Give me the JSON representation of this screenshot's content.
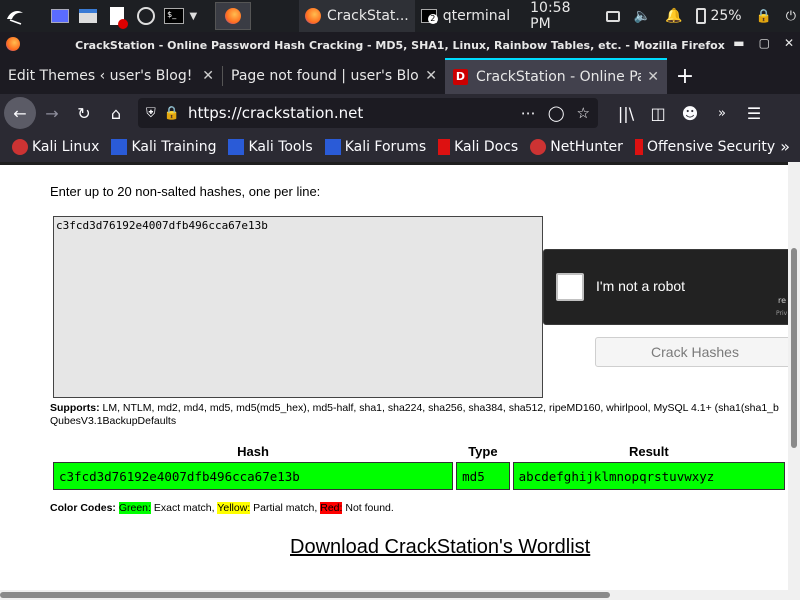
{
  "taskbar": {
    "apps": [
      {
        "icon": "firefox-icon",
        "label": "CrackStat..."
      },
      {
        "icon": "terminal-icon",
        "label": "qterminal",
        "badge": "2"
      }
    ],
    "clock": "10:58 PM",
    "battery": "25%"
  },
  "window": {
    "title": "CrackStation - Online Password Hash Cracking - MD5, SHA1, Linux, Rainbow Tables, etc. - Mozilla Firefox"
  },
  "tabs": [
    {
      "label": "Edit Themes ‹ user's Blog! —"
    },
    {
      "label": "Page not found | user's Blog!"
    },
    {
      "label": "CrackStation - Online Pas"
    }
  ],
  "urlbar": {
    "url": "https://crackstation.net"
  },
  "bookmarks": [
    {
      "label": "Kali Linux",
      "icon": "kali-dragon-icon"
    },
    {
      "label": "Kali Training",
      "icon": "kali-training-icon"
    },
    {
      "label": "Kali Tools",
      "icon": "kali-tools-icon"
    },
    {
      "label": "Kali Forums",
      "icon": "kali-forums-icon"
    },
    {
      "label": "Kali Docs",
      "icon": "kali-docs-icon"
    },
    {
      "label": "NetHunter",
      "icon": "nethunter-icon"
    },
    {
      "label": "Offensive Security",
      "icon": "offsec-icon"
    }
  ],
  "page": {
    "instructions": "Enter up to 20 non-salted hashes, one per line:",
    "hash_input": "c3fcd3d76192e4007dfb496cca67e13b",
    "captcha_label": "I'm not a robot",
    "captcha_re": "re",
    "captcha_privacy": "Priv",
    "crack_button": "Crack Hashes",
    "supports_label": "Supports:",
    "supports_line1": "LM, NTLM, md2, md4, md5, md5(md5_hex), md5-half, sha1, sha224, sha256, sha384, sha512, ripeMD160, whirlpool, MySQL 4.1+ (sha1(sha1_b",
    "supports_line2": "QubesV3.1BackupDefaults",
    "results": {
      "headers": {
        "hash": "Hash",
        "type": "Type",
        "result": "Result"
      },
      "rows": [
        {
          "hash": "c3fcd3d76192e4007dfb496cca67e13b",
          "type": "md5",
          "result": "abcdefghijklmnopqrstuvwxyz"
        }
      ]
    },
    "color_codes": {
      "label": "Color Codes:",
      "green": "Green:",
      "green_desc": "Exact match,",
      "yellow": "Yellow:",
      "yellow_desc": "Partial match,",
      "red": "Red:",
      "red_desc": "Not found."
    },
    "wordlist_link": "Download CrackStation's Wordlist"
  }
}
